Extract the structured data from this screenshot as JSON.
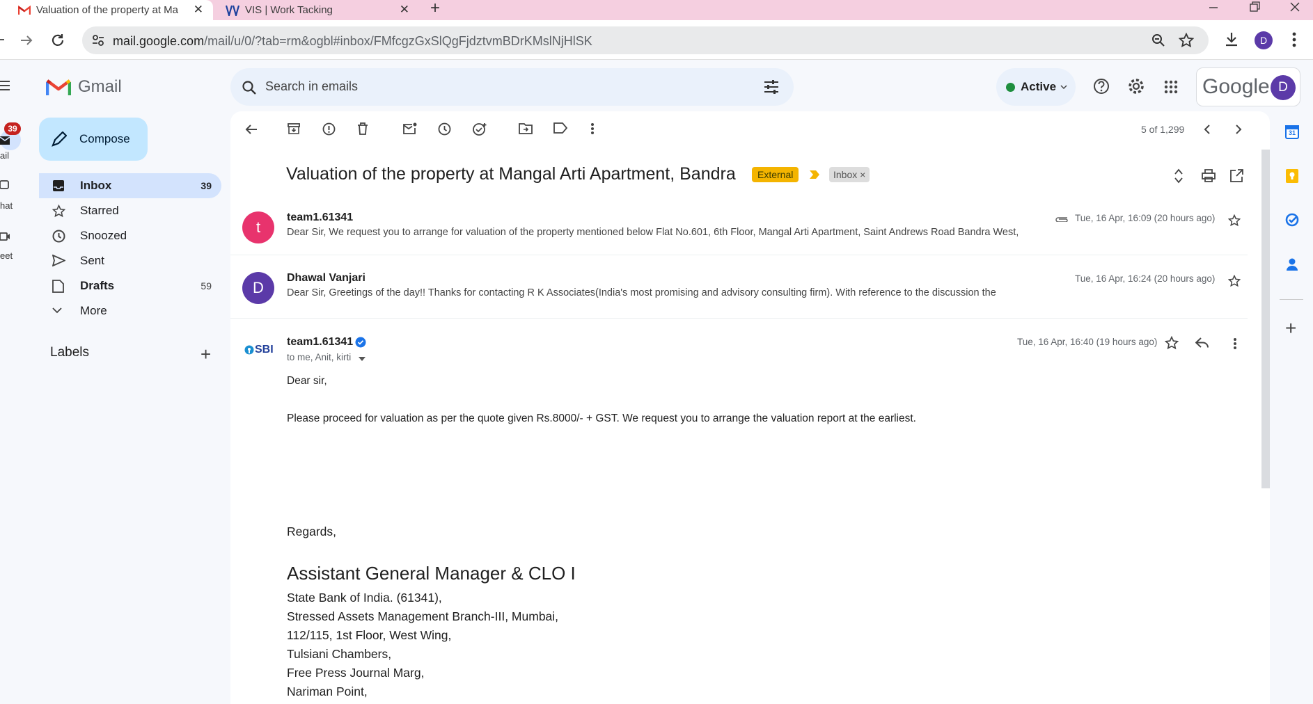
{
  "browser": {
    "tabs": [
      {
        "title": "Valuation of the property at Ma",
        "close": "✕"
      },
      {
        "title": "VIS | Work Tacking",
        "close": "✕"
      }
    ],
    "new_tab": "+",
    "url_main": "mail.google.com",
    "url_path": "/mail/u/0/?tab=rm&ogbl#inbox/FMfcgzGxSlQgFjdztvmBDrKMslNjHlSK",
    "profile_initial": "D"
  },
  "rail": {
    "mail_badge": "39",
    "mail_label": "ail",
    "chat_label": "hat",
    "meet_label": "eet"
  },
  "gmail": {
    "logo_text": "Gmail",
    "search_placeholder": "Search in emails",
    "status": "Active",
    "google_word": "Google",
    "account_initial": "D"
  },
  "nav": {
    "compose": "Compose",
    "items": [
      {
        "label": "Inbox",
        "count": "39",
        "icon": "inbox-icon"
      },
      {
        "label": "Starred",
        "count": "",
        "icon": "star-icon"
      },
      {
        "label": "Snoozed",
        "count": "",
        "icon": "clock-icon"
      },
      {
        "label": "Sent",
        "count": "",
        "icon": "send-icon"
      },
      {
        "label": "Drafts",
        "count": "59",
        "icon": "draft-icon"
      },
      {
        "label": "More",
        "count": "",
        "icon": "chevron-down-icon"
      }
    ],
    "labels_heading": "Labels",
    "labels_add": "+"
  },
  "thread": {
    "pager": "5 of 1,299",
    "subject": "Valuation of the property at Mangal Arti Apartment, Bandra",
    "badge_external": "External",
    "badge_inbox": "Inbox ×",
    "messages": [
      {
        "avatar": "t",
        "avatar_color": "#e8336d",
        "sender": "team1.61341",
        "snippet": "Dear Sir, We request you to arrange for valuation of the property mentioned below Flat No.601, 6th Floor, Mangal Arti Apartment, Saint Andrews Road Bandra West,",
        "date": "Tue, 16 Apr, 16:09 (20 hours ago)"
      },
      {
        "avatar": "D",
        "avatar_color": "#5b3aa8",
        "sender": "Dhawal Vanjari",
        "snippet": "Dear Sir, Greetings of the day!! Thanks for contacting R K Associates(India's most promising and advisory consulting firm). With reference to the discussion the",
        "date": "Tue, 16 Apr, 16:24 (20 hours ago)"
      }
    ],
    "open_message": {
      "sender_logo": "SBI",
      "sender": "team1.61341",
      "recipients": "to me, Anit, kirti",
      "date": "Tue, 16 Apr, 16:40 (19 hours ago)",
      "greeting": "Dear sir,",
      "body": "Please proceed for valuation as per the quote given Rs.8000/- + GST. We request you to arrange the valuation report at the earliest.",
      "regards": "Regards,",
      "sig_title": "Assistant General Manager & CLO I",
      "sig_lines": [
        "State Bank of India. (61341),",
        "Stressed Assets Management Branch-III, Mumbai,",
        "112/115, 1st Floor, West Wing,",
        "Tulsiani Chambers,",
        "Free Press Journal Marg,",
        "Nariman Point,"
      ]
    }
  },
  "right_rail": {
    "calendar_day": "31",
    "add": "+"
  }
}
